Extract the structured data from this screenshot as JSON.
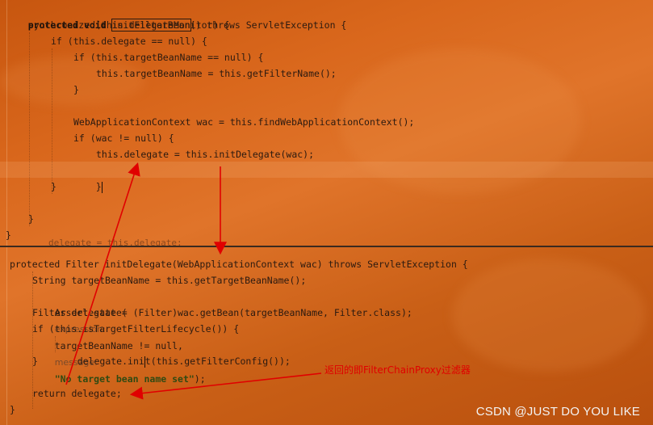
{
  "top_pane": {
    "lines": [
      {
        "t1": "protected void ",
        "t2": "initFilterBean",
        "t3": "() throws ServletException {"
      },
      {
        "t": "synchronized(this.delegateMonitor) {"
      },
      {
        "t": "if (this.delegate == null) {"
      },
      {
        "t": "if (this.targetBeanName == null) {"
      },
      {
        "t": "this.targetBeanName = this.getFilterName();"
      },
      {
        "t": "}"
      },
      {
        "t": "WebApplicationContext wac = this.findWebApplicationContext();"
      },
      {
        "t": "if (wac != null) {"
      },
      {
        "t": "this.delegate = this.initDelegate(wac);"
      },
      {
        "t": "}"
      },
      {
        "t": "}"
      },
      {
        "t": "}"
      },
      {
        "t": "}"
      }
    ],
    "ghost_line": "delegate = this.delegate;"
  },
  "bottom_pane": {
    "lines": [
      {
        "t": "protected Filter initDelegate(WebApplicationContext wac) throws ServletException {"
      },
      {
        "t": "String targetBeanName = this.getTargetBeanName();"
      },
      {
        "a": "Assert.state(",
        "hint1": "expression:",
        "b": "targetBeanName != null, ",
        "hint2": "message:",
        "c": "\"No target bean name set\"",
        "d": ");"
      },
      {
        "t": "Filter delegate = (Filter)wac.getBean(targetBeanName, Filter.class);"
      },
      {
        "t": "if (this.isTargetFilterLifecycle()) {"
      },
      {
        "a": "delegate.ini",
        "b": "t(this.getFilterConfig());"
      },
      {
        "t": "}"
      },
      {
        "t": "return delegate;"
      },
      {
        "t": "}"
      }
    ]
  },
  "annotation": "返回的即FilterChainProxy过滤器",
  "watermark": "CSDN @JUST DO YOU LIKE",
  "colors": {
    "arrow": "#e00000",
    "background": "#d9671c"
  }
}
